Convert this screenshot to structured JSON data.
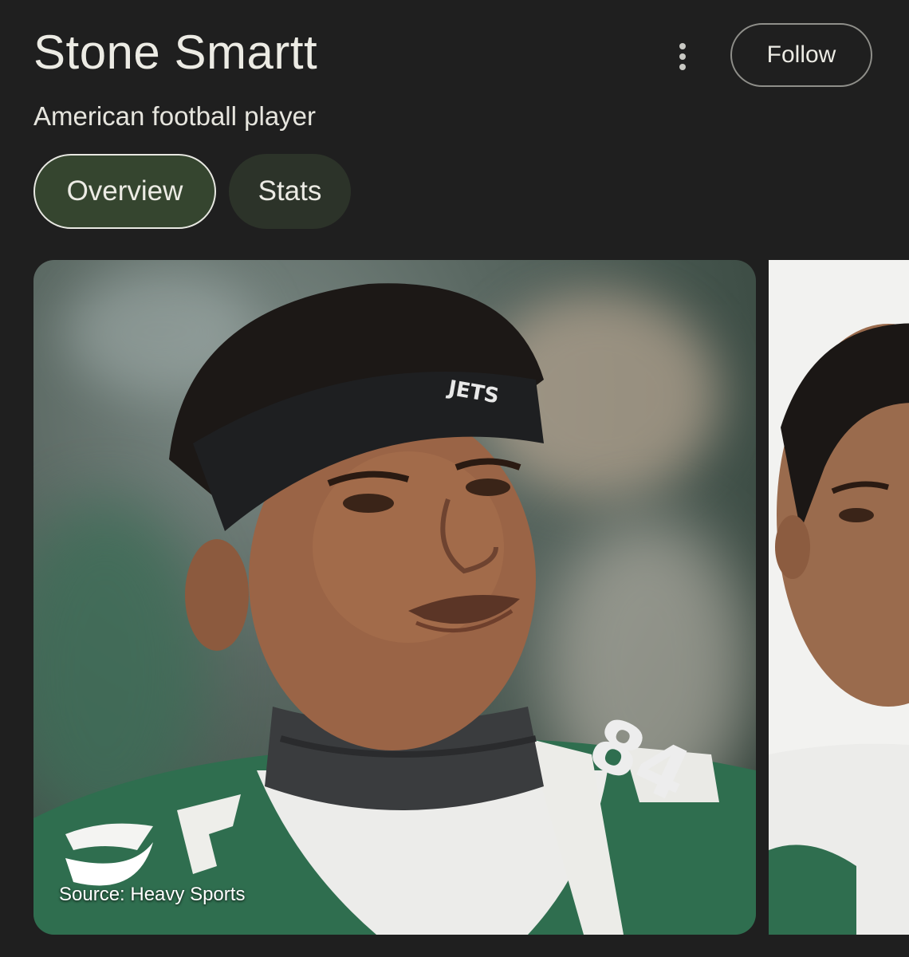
{
  "header": {
    "title": "Stone Smartt",
    "subtitle": "American football player",
    "follow_label": "Follow",
    "more_icon": "more-vert-icon"
  },
  "tabs": [
    {
      "label": "Overview",
      "selected": true
    },
    {
      "label": "Stats",
      "selected": false
    }
  ],
  "images": [
    {
      "caption": "Source: Heavy Sports",
      "headband_text": "JETS",
      "jersey_number": "84"
    },
    {
      "caption": ""
    }
  ],
  "colors": {
    "background": "#1f1f1f",
    "chip_selected": "#35452f",
    "chip_unselected": "#2c3329",
    "jersey_green": "#2f6e4f"
  }
}
